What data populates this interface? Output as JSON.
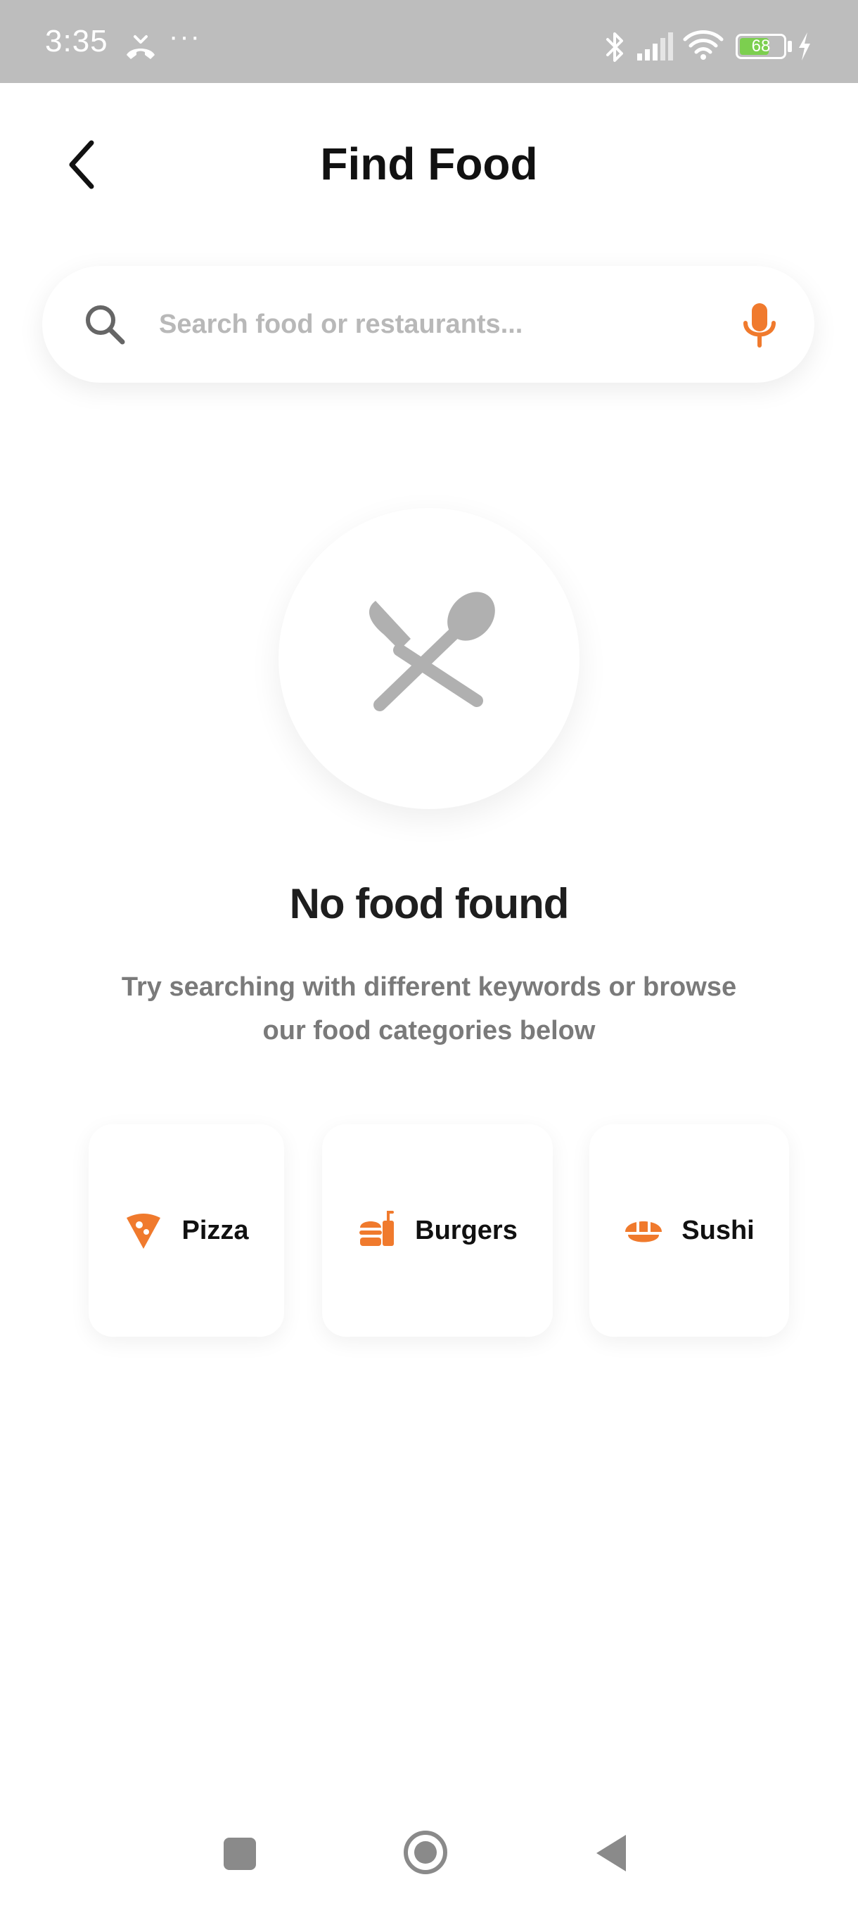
{
  "status_bar": {
    "time": "3:35",
    "more": "···",
    "battery_level": "68",
    "battery_fraction": 0.68
  },
  "header": {
    "title": "Find Food",
    "back_icon": "chevron-left-icon"
  },
  "search": {
    "value": "",
    "placeholder": "Search food or restaurants...",
    "icon": "search-icon",
    "mic_icon": "microphone-icon"
  },
  "empty_state": {
    "icon": "utensils-icon",
    "title": "No food found",
    "message": "Try searching with different keywords or browse our food categories below"
  },
  "categories": [
    {
      "label": "Pizza",
      "icon": "pizza-slice-icon"
    },
    {
      "label": "Burgers",
      "icon": "burger-icon"
    },
    {
      "label": "Sushi",
      "icon": "sushi-icon"
    }
  ],
  "nav_bar": {
    "recent_icon": "square-icon",
    "home_icon": "circle-icon",
    "back_icon": "triangle-back-icon"
  },
  "colors": {
    "accent": "#f07a2d",
    "status_bar_bg": "#bdbdbd",
    "text_primary": "#111111",
    "text_secondary": "#7a7a7a",
    "placeholder": "#b8b8b8",
    "icon_gray": "#b0b0b0",
    "battery_green": "#7ccf4f"
  }
}
